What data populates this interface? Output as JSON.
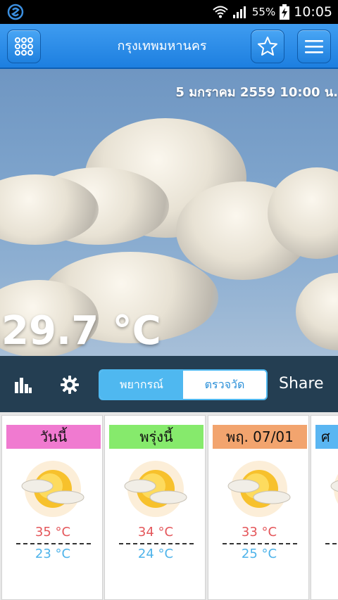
{
  "status_bar": {
    "battery": "55%",
    "time": "10:05"
  },
  "app_bar": {
    "title": "กรุงเทพมหานคร"
  },
  "hero": {
    "datetime": "5  มกราคม  2559  10:00 น.",
    "temperature": "29.7 °C"
  },
  "toolbar": {
    "tabs": [
      "พยากรณ์",
      "ตรวจวัด"
    ],
    "active_tab": 0,
    "share_label": "Share"
  },
  "forecast": [
    {
      "day": "วันนี้",
      "high": "35 °C",
      "low": "23 °C",
      "color": "#f07ad0",
      "icon": "sun-cloud-icon"
    },
    {
      "day": "พรุ่งนี้",
      "high": "34 °C",
      "low": "24 °C",
      "color": "#86ea6c",
      "icon": "sun-cloud-icon"
    },
    {
      "day": "พฤ.  07/01",
      "high": "33 °C",
      "low": "25 °C",
      "color": "#f2a46e",
      "icon": "sun-cloud-icon"
    },
    {
      "day": "ศ",
      "high": "",
      "low": "",
      "color": "#5ab6f2",
      "icon": "sun-cloud-icon"
    }
  ],
  "colors": {
    "app_bar": "#1d7fe0",
    "toolbar": "#243e52",
    "high_temp": "#e4565a",
    "low_temp": "#4db3ea",
    "accent": "#4fb8f0"
  }
}
